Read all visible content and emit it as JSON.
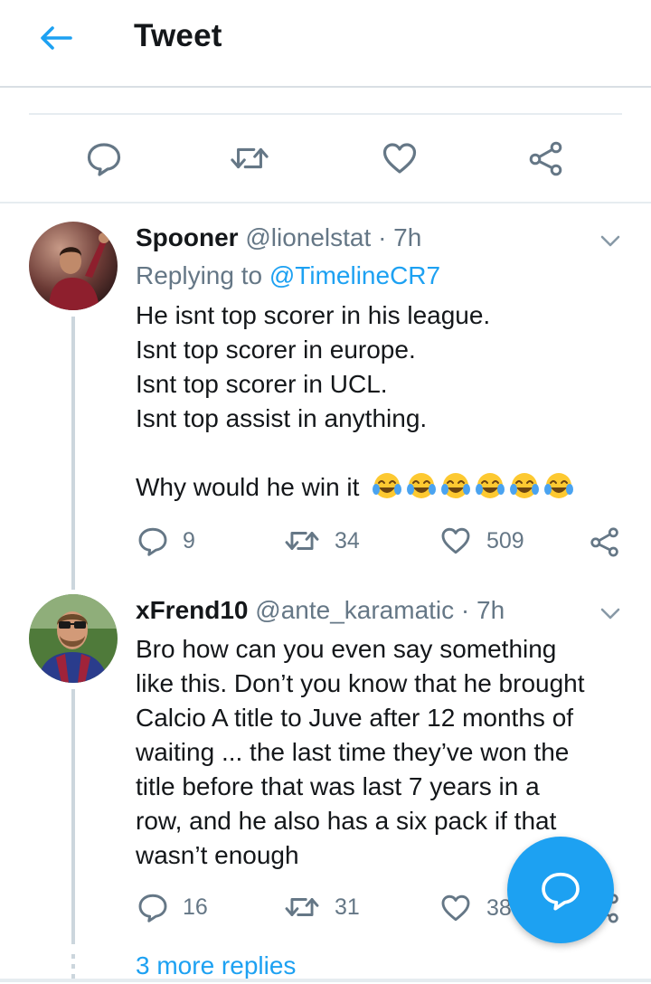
{
  "header": {
    "title": "Tweet",
    "back_icon": "arrow-left-icon"
  },
  "accent_color": "#1da1f2",
  "action_bar": {
    "icons": [
      "reply-icon",
      "retweet-icon",
      "like-icon",
      "share-icon"
    ]
  },
  "replies": [
    {
      "display_name": "Spooner",
      "handle": "@lionelstat",
      "separator": "·",
      "time": "7h",
      "replying_prefix": "Replying to",
      "replying_to": "@TimelineCR7",
      "lines": [
        "He isnt top scorer in his league.",
        "Isnt top scorer in europe.",
        "Isnt top scorer in UCL.",
        "Isnt top assist in anything.",
        "",
        "Why would he win it"
      ],
      "emoji": "😂😂😂😂😂😂",
      "replies_count": "9",
      "retweets_count": "34",
      "likes_count": "509"
    },
    {
      "display_name": "xFrend10",
      "handle": "@ante_karamatic",
      "separator": "·",
      "time": "7h",
      "lines": [
        "Bro how can you even say something",
        "like this. Don’t you know that he brought",
        "Calcio A title to Juve after 12 months of",
        "waiting ... the last time they’ve won the",
        "title before that was last 7 years in a",
        "row, and he also has a six pack if that",
        "wasn’t enough"
      ],
      "replies_count": "16",
      "retweets_count": "31",
      "likes_count": "38"
    }
  ],
  "more_replies": "3 more replies"
}
